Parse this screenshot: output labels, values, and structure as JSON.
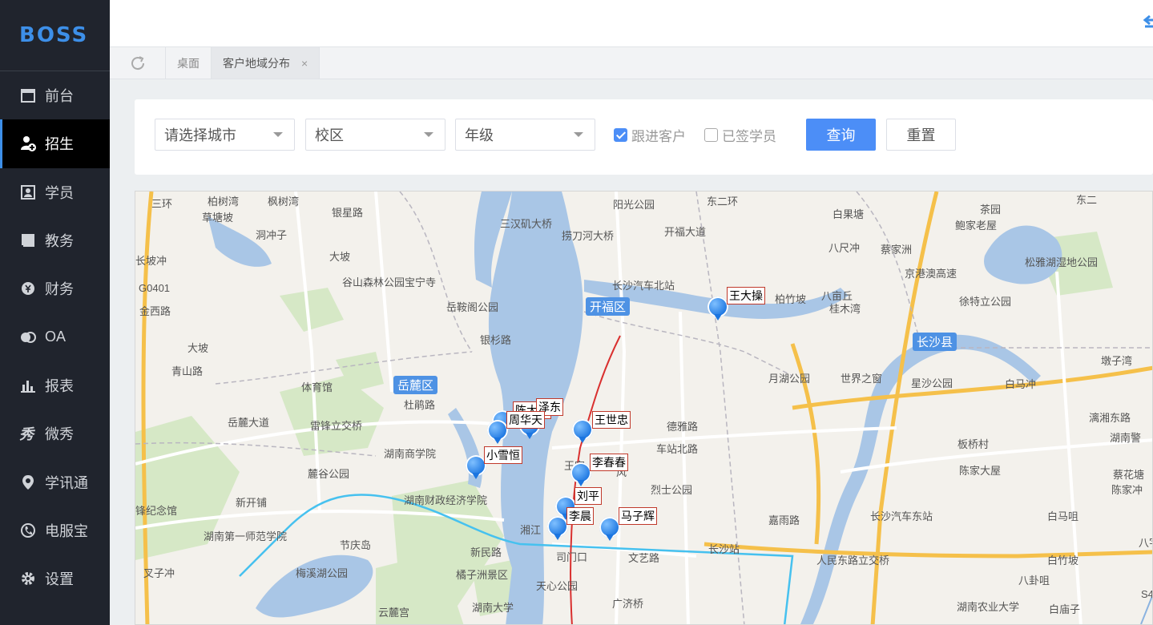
{
  "brand": {
    "logo": "BOSS"
  },
  "sidebar": {
    "items": [
      {
        "label": "前台",
        "icon": "calendar-icon",
        "active": false
      },
      {
        "label": "招生",
        "icon": "add-user-icon",
        "active": true
      },
      {
        "label": "学员",
        "icon": "student-card-icon",
        "active": false
      },
      {
        "label": "教务",
        "icon": "book-icon",
        "active": false
      },
      {
        "label": "财务",
        "icon": "yen-icon",
        "active": false
      },
      {
        "label": "OA",
        "icon": "chat-bubbles-icon",
        "active": false
      },
      {
        "label": "报表",
        "icon": "bar-chart-icon",
        "active": false
      },
      {
        "label": "微秀",
        "icon": "xiu-icon",
        "active": false
      },
      {
        "label": "学讯通",
        "icon": "location-icon",
        "active": false
      },
      {
        "label": "电服宝",
        "icon": "phone-service-icon",
        "active": false
      },
      {
        "label": "设置",
        "icon": "gear-icon",
        "active": false
      }
    ]
  },
  "tabs": [
    {
      "label": "桌面",
      "active": false,
      "closable": false
    },
    {
      "label": "客户地域分布",
      "active": true,
      "closable": true,
      "close_symbol": "×"
    }
  ],
  "filters": {
    "city_placeholder": "请选择城市",
    "campus_placeholder": "校区",
    "grade_placeholder": "年级",
    "follow_label": "跟进客户",
    "follow_checked": true,
    "signed_label": "已签学员",
    "signed_checked": false,
    "query_label": "查询",
    "reset_label": "重置"
  },
  "map": {
    "districts": [
      "开福区",
      "岳麓区",
      "长沙县"
    ],
    "places": [
      "银星路",
      "草塘坡",
      "枫树湾",
      "柏树湾",
      "洞冲子",
      "大坡",
      "谷山森林公园宝宁寺",
      "岳鞍阁公园",
      "G0401",
      "金西路",
      "长坡冲",
      "青山路",
      "大坡",
      "体育馆",
      "杜鹃路",
      "岳麓大道",
      "雷锋立交桥",
      "湖南商学院",
      "麓谷公园",
      "新开铺",
      "锋纪念馆",
      "湖南第一师范学院",
      "节庆岛",
      "梅溪湖公园",
      "叉子冲",
      "湖南财政经济学院",
      "新民路",
      "橘子洲景区",
      "天心公园",
      "湖南大学",
      "云麓宫",
      "三汉矶大桥",
      "捞刀河大桥",
      "阳光公园",
      "长沙汽车北站",
      "开福大道",
      "银杉路",
      "德雅路",
      "车站北路",
      "烈士公园",
      "王家",
      "风",
      "湘江",
      "司门口",
      "文艺路",
      "长沙站",
      "广济桥",
      "嘉雨路",
      "白果塘",
      "八尺冲",
      "蔡家洲",
      "柏竹坡",
      "八亩丘",
      "桂木湾",
      "徐特立公园",
      "茶园",
      "鲍家老屋",
      "松雅湖湿地公园",
      "京港澳高速",
      "月湖公园",
      "世界之窗",
      "星沙公园",
      "白马冲",
      "墩子湾",
      "漓湘东路",
      "湖南警",
      "板桥村",
      "陈家大屋",
      "蔡花塘",
      "陈家冲",
      "长沙汽车东站",
      "白马咀",
      "人民东路立交桥",
      "白竹坡",
      "八卦咀",
      "湖南农业大学",
      "白庙子",
      "八字",
      "S4",
      "东二环",
      "三环",
      "东二"
    ],
    "markers": [
      {
        "name": "王大操"
      },
      {
        "name": "陈大操"
      },
      {
        "name": "泽东"
      },
      {
        "name": "周华天"
      },
      {
        "name": "王世忠"
      },
      {
        "name": "小雪恒"
      },
      {
        "name": "李春春"
      },
      {
        "name": "刘平"
      },
      {
        "name": "李晨"
      },
      {
        "name": "马子辉"
      }
    ]
  },
  "colors": {
    "sidebar_bg": "#20242d",
    "accent": "#4c8ef7",
    "water": "#a9c6e6",
    "park": "#cfe4c0",
    "highway": "#f5c04a",
    "metro": "#46c1ef",
    "rail": "#d9302f"
  }
}
